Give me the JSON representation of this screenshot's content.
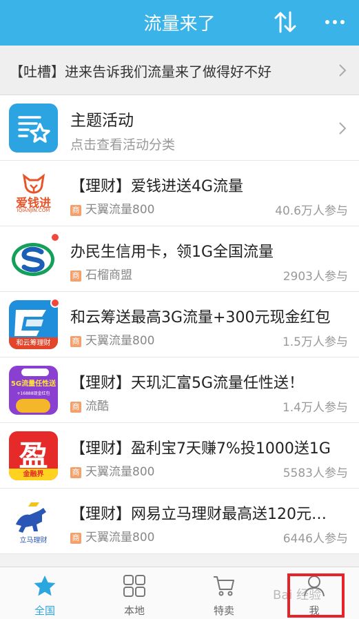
{
  "header": {
    "title": "流量来了",
    "sort_icon": "sort-arrows-icon",
    "more_icon": "more-dots-icon"
  },
  "feedback": {
    "text": "【吐槽】进来告诉我们流量来了做得好不好"
  },
  "theme": {
    "title": "主题活动",
    "subtitle": "点击查看活动分类"
  },
  "items": [
    {
      "title": "【理财】爱钱进送4G流量",
      "shop": "天翼流量800",
      "count": "40.6万人参与",
      "shop_badge": "商",
      "logo_text": "爱钱进",
      "logo_sub": "IQIANJIN.COM"
    },
    {
      "title": "办民生信用卡，领1G全国流量",
      "shop": "石榴商盟",
      "count": "2903人参与",
      "shop_badge": "商"
    },
    {
      "title": "和云筹送最高3G流量+300元现金红包",
      "shop": "天翼流量800",
      "count": "1.5万人参与",
      "shop_badge": "商",
      "logo_text": "和云筹理财"
    },
    {
      "title": "【理财】天玑汇富5G流量任性送！",
      "shop": "流酷",
      "count": "1.4万人参与",
      "shop_badge": "商",
      "logo_text": "5G流量任性送",
      "logo_sub": "+16888现金红包"
    },
    {
      "title": "【理财】盈利宝7天赚7%投1000送1G",
      "shop": "天翼流量800",
      "count": "5583人参与",
      "shop_badge": "商",
      "logo_text": "盈",
      "logo_sub": "金融界"
    },
    {
      "title": "【理财】网易立马理财最高送120元…",
      "shop": "天翼流量800",
      "count": "6446人参与",
      "shop_badge": "商",
      "logo_text": "立马理财"
    }
  ],
  "tabs": [
    {
      "label": "全国",
      "icon": "star-icon",
      "active": true
    },
    {
      "label": "本地",
      "icon": "grid-icon"
    },
    {
      "label": "特卖",
      "icon": "cart-icon"
    },
    {
      "label": "我",
      "icon": "user-icon"
    }
  ],
  "watermark": "Bai 经验",
  "colors": {
    "accent": "#39b3e8",
    "active_tab": "#2ba6de",
    "badge": "#f3a06c",
    "dot": "#f2473d",
    "highlight": "#e8222a"
  }
}
